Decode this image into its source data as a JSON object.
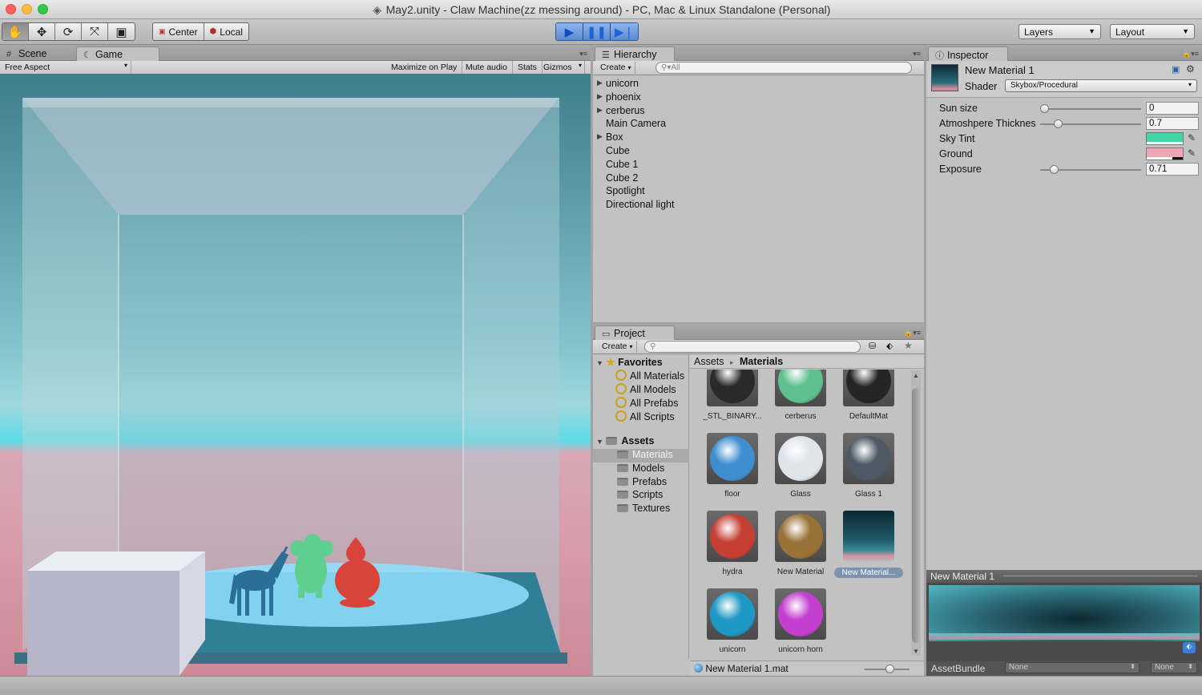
{
  "window": {
    "title": "May2.unity - Claw Machine(zz messing around) - PC, Mac & Linux Standalone (Personal)"
  },
  "toolbar": {
    "tools": [
      {
        "name": "hand-tool-icon",
        "glyph": "✋"
      },
      {
        "name": "move-tool-icon",
        "glyph": "✥"
      },
      {
        "name": "rotate-tool-icon",
        "glyph": "⟳"
      },
      {
        "name": "scale-tool-icon",
        "glyph": "⤧"
      },
      {
        "name": "rect-tool-icon",
        "glyph": "▣"
      }
    ],
    "pivot": "Center",
    "space": "Local",
    "layers": "Layers",
    "layout": "Layout"
  },
  "scene_panel": {
    "tabs": {
      "scene": "Scene",
      "game": "Game"
    },
    "aspect": "Free Aspect",
    "maximize": "Maximize on Play",
    "mute": "Mute audio",
    "stats": "Stats",
    "gizmos": "Gizmos"
  },
  "hierarchy": {
    "tab": "Hierarchy",
    "create": "Create",
    "search_placeholder": "All",
    "items": [
      {
        "label": "unicorn",
        "expandable": true
      },
      {
        "label": "phoenix",
        "expandable": true
      },
      {
        "label": "cerberus",
        "expandable": true
      },
      {
        "label": "Main Camera",
        "expandable": false
      },
      {
        "label": "Box",
        "expandable": true
      },
      {
        "label": "Cube",
        "expandable": false
      },
      {
        "label": "Cube 1",
        "expandable": false
      },
      {
        "label": "Cube 2",
        "expandable": false
      },
      {
        "label": "Spotlight",
        "expandable": false
      },
      {
        "label": "Directional light",
        "expandable": false
      }
    ]
  },
  "project": {
    "tab": "Project",
    "create": "Create",
    "favorites_label": "Favorites",
    "favorites": [
      "All Materials",
      "All Models",
      "All Prefabs",
      "All Scripts"
    ],
    "assets_label": "Assets",
    "folders": [
      "Materials",
      "Models",
      "Prefabs",
      "Scripts",
      "Textures"
    ],
    "selected_folder": "Materials",
    "breadcrumb": {
      "root": "Assets",
      "current": "Materials"
    },
    "materials": [
      {
        "label": "_STL_BINARY...",
        "color": "#2a2a2a"
      },
      {
        "label": "cerberus",
        "color": "#5fbf8f"
      },
      {
        "label": "DefaultMat",
        "color": "#252525"
      },
      {
        "label": "floor",
        "color": "#3f8fd0"
      },
      {
        "label": "Glass",
        "color": "#dfe3ea"
      },
      {
        "label": "Glass 1",
        "color": "#4d5a66"
      },
      {
        "label": "hydra",
        "color": "#c63f34"
      },
      {
        "label": "New Material",
        "color": "#9a7238"
      },
      {
        "label": "New Material...",
        "color": "skybox",
        "selected": true
      },
      {
        "label": "unicorn",
        "color": "#1e98c4"
      },
      {
        "label": "unicorn horn",
        "color": "#c43fd0"
      }
    ],
    "footer_file": "New Material 1.mat"
  },
  "inspector": {
    "tab": "Inspector",
    "material_name": "New Material 1",
    "shader_label": "Shader",
    "shader_value": "Skybox/Procedural",
    "props": {
      "sun_size": {
        "label": "Sun size",
        "value": "0",
        "fraction": 0.0
      },
      "atmosphere": {
        "label": "Atmoshpere Thicknes",
        "value": "0.7",
        "fraction": 0.14
      },
      "sky_tint": {
        "label": "Sky Tint",
        "color": "#3fd6a8"
      },
      "ground": {
        "label": "Ground",
        "color": "#f0a7b5"
      },
      "exposure": {
        "label": "Exposure",
        "value": "0.71",
        "fraction": 0.1
      }
    },
    "preview_title": "New Material 1",
    "asset_bundle": {
      "label": "AssetBundle",
      "value1": "None",
      "value2": "None"
    }
  }
}
